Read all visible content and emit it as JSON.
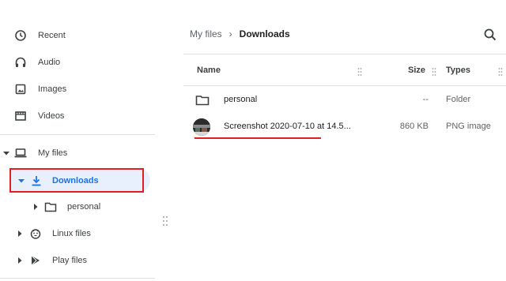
{
  "sidebar": {
    "recent": "Recent",
    "audio": "Audio",
    "images": "Images",
    "videos": "Videos",
    "my_files": "My files",
    "downloads": "Downloads",
    "personal": "personal",
    "linux_files": "Linux files",
    "play_files": "Play files"
  },
  "breadcrumb": {
    "root": "My files",
    "separator": "›",
    "current": "Downloads"
  },
  "columns": {
    "name": "Name",
    "size": "Size",
    "types": "Types"
  },
  "files": [
    {
      "name": "personal",
      "size": "--",
      "type": "Folder",
      "icon": "folder-icon"
    },
    {
      "name": "Screenshot 2020-07-10 at 14.5...",
      "size": "860 KB",
      "type": "PNG image",
      "icon": "image-thumbnail"
    }
  ],
  "colors": {
    "accent": "#1a73e8",
    "selected_bg": "#e8f0fe",
    "annotation_red": "#e02020"
  }
}
